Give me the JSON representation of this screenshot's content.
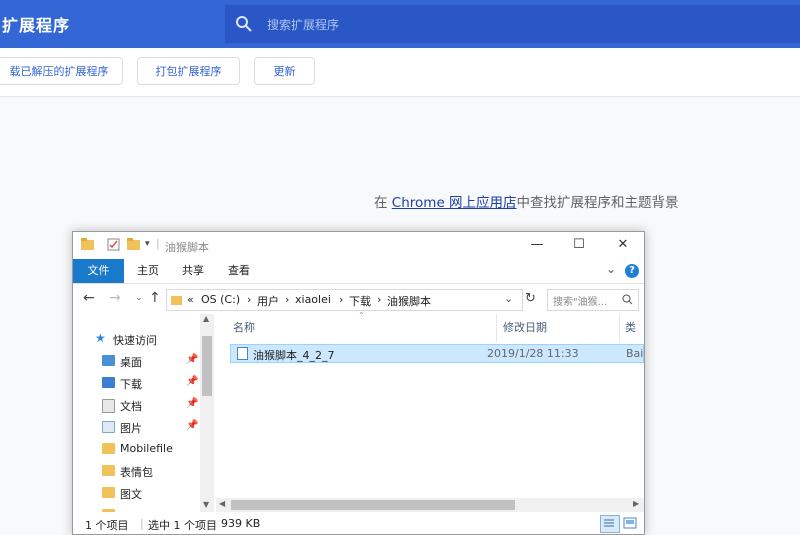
{
  "header": {
    "title": "扩展程序",
    "search_placeholder": "搜索扩展程序"
  },
  "toolbar": {
    "load_unpacked": "载已解压的扩展程序",
    "pack_extension": "打包扩展程序",
    "update": "更新"
  },
  "store_line": {
    "prefix": "在 ",
    "link": "Chrome 网上应用店",
    "suffix": "中查找扩展程序和主题背景"
  },
  "explorer": {
    "title": "油猴脚本",
    "ribbon_tabs": [
      "文件",
      "主页",
      "共享",
      "查看"
    ],
    "address": [
      "«",
      "OS (C:)",
      "›",
      "用户",
      "›",
      "xiaolei",
      "›",
      "下载",
      "›",
      "油猴脚本"
    ],
    "search_placeholder": "搜索\"油猴...",
    "nav_items": [
      {
        "label": "快速访问",
        "icon": "star-icon"
      },
      {
        "label": "桌面",
        "icon": "desktop-icon",
        "pinned": true
      },
      {
        "label": "下载",
        "icon": "downloads-icon",
        "pinned": true
      },
      {
        "label": "文档",
        "icon": "documents-icon",
        "pinned": true
      },
      {
        "label": "图片",
        "icon": "pictures-icon",
        "pinned": true
      },
      {
        "label": "Mobilefile",
        "icon": "folder-icon"
      },
      {
        "label": "表情包",
        "icon": "folder-icon"
      },
      {
        "label": "图文",
        "icon": "folder-icon"
      }
    ],
    "columns": [
      "名称",
      "修改日期",
      "类型"
    ],
    "files": [
      {
        "name": "油猴脚本_4_2_7",
        "modified": "2019/1/28 11:33",
        "type": "Bai"
      }
    ],
    "status": {
      "count": "1 个项目",
      "selected": "选中 1 个项目",
      "size": "939 KB"
    }
  },
  "colors": {
    "chrome_blue": "#3367d6",
    "ribbon_file": "#1979ca",
    "selection": "#cce8ff"
  }
}
